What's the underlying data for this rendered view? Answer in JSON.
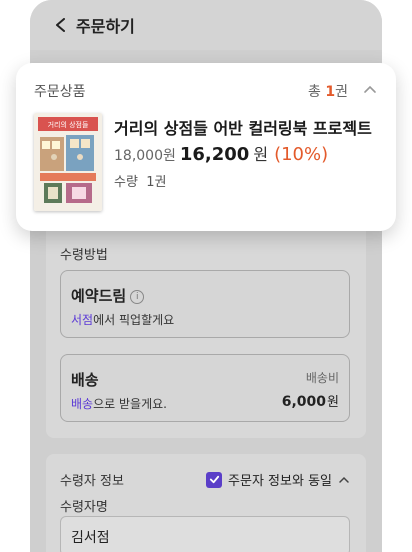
{
  "header": {
    "title": "주문하기"
  },
  "product_card": {
    "heading": "주문상품",
    "count_prefix": "총 ",
    "count_value": "1",
    "count_unit": "권",
    "item": {
      "title": "거리의 상점들 어반 컬러링북 프로젝트",
      "original_price": "18,000원",
      "sale_price": "16,200",
      "sale_unit": "원",
      "discount": "(10%)",
      "quantity_label": "수량",
      "quantity_value": "1권",
      "cover_text": "거리의 상점들"
    }
  },
  "receive_method": {
    "title": "수령방법",
    "options": [
      {
        "title": "예약드림",
        "accent": "서점",
        "rest": "에서 픽업할게요"
      },
      {
        "title": "배송",
        "accent": "배송",
        "rest": "으로 받을게요.",
        "fee_label": "배송비",
        "fee_value": "6,000",
        "fee_unit": "원"
      }
    ]
  },
  "recipient": {
    "title": "수령자 정보",
    "same_as_orderer": "주문자 정보와 동일",
    "name_label": "수령자명",
    "name_value": "김서점"
  },
  "colors": {
    "accent": "#5b39d6",
    "discount": "#e35a2b",
    "checkbox": "#5a3ec8"
  }
}
